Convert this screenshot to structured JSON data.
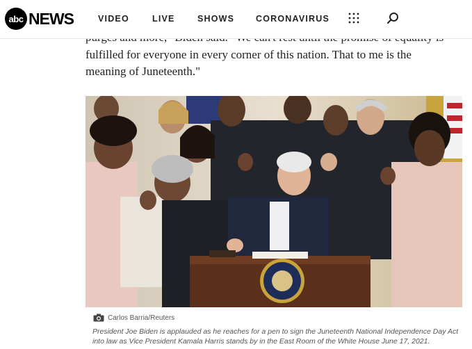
{
  "brand": {
    "logo_mark": "abc",
    "logo_word": "NEWS"
  },
  "nav": {
    "items": [
      "VIDEO",
      "LIVE",
      "SHOWS",
      "CORONAVIRUS"
    ],
    "menu_icon": "grid-icon",
    "search_icon": "search-icon"
  },
  "article": {
    "paragraph_lines": [
      "purges and more,\" Biden said. \"We can't rest until the promise of equality is",
      "fulfilled for everyone in every corner of this nation. That to me is the",
      "meaning of Juneteenth.\""
    ]
  },
  "photo": {
    "credit": "Carlos Barria/Reuters",
    "camera_icon": "camera-icon",
    "caption": "President Joe Biden is applauded as he reaches for a pen to sign the Juneteenth National Independence Day Act into law as Vice President Kamala Harris stands by in the East Room of the White House June 17, 2021."
  }
}
